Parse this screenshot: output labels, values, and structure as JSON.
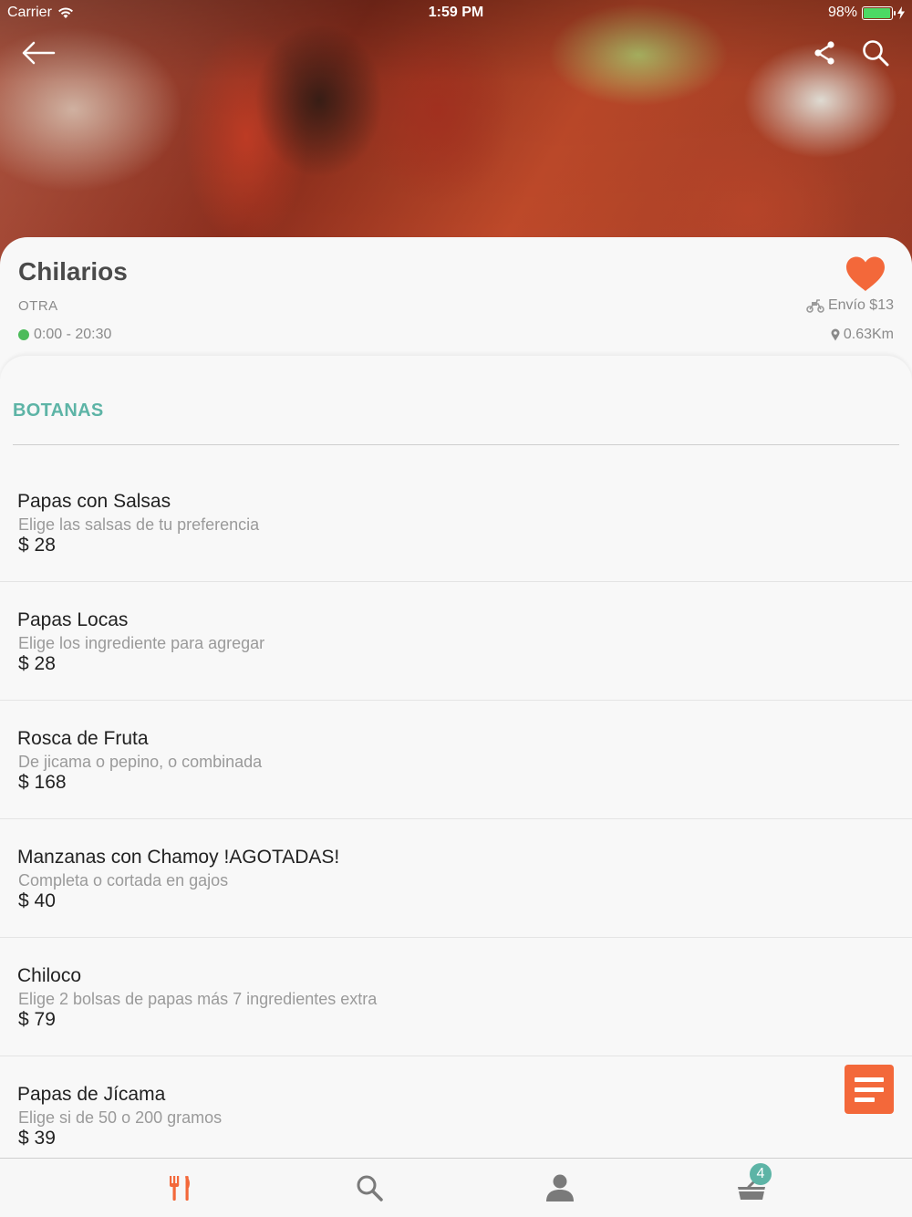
{
  "status_bar": {
    "carrier": "Carrier",
    "time": "1:59 PM",
    "battery": "98%",
    "battery_level": 0.98
  },
  "nav": {
    "back_icon": "arrow-left-icon",
    "share_icon": "share-icon",
    "search_icon": "search-icon"
  },
  "restaurant": {
    "name": "Chilarios",
    "category": "OTRA",
    "hours": "0:00 - 20:30",
    "delivery": "Envío $13",
    "distance": "0.63Km",
    "favorite": true
  },
  "menu": {
    "section_title": "BOTANAS",
    "items": [
      {
        "name": "Papas con Salsas",
        "description": "Elige las salsas de tu preferencia",
        "price": "$ 28"
      },
      {
        "name": "Papas Locas",
        "description": "Elige los ingrediente para agregar",
        "price": "$ 28"
      },
      {
        "name": "Rosca de Fruta",
        "description": "De jicama o pepino, o combinada",
        "price": "$ 168"
      },
      {
        "name": "Manzanas con Chamoy !AGOTADAS!",
        "description": "Completa o cortada en gajos",
        "price": "$ 40"
      },
      {
        "name": "Chiloco",
        "description": "Elige 2 bolsas de papas  más 7 ingredientes extra",
        "price": "$ 79"
      },
      {
        "name": "Papas de Jícama",
        "description": "Elige si de 50  o 200 gramos",
        "price": "$ 39"
      }
    ]
  },
  "tab_bar": {
    "tabs": [
      "restaurant-icon",
      "search-icon",
      "user-icon",
      "cart-icon"
    ],
    "active": "restaurant-icon",
    "cart_count": "4"
  },
  "colors": {
    "accent": "#f3683a",
    "teal": "#5db4a6",
    "open": "#4cbb5a"
  }
}
